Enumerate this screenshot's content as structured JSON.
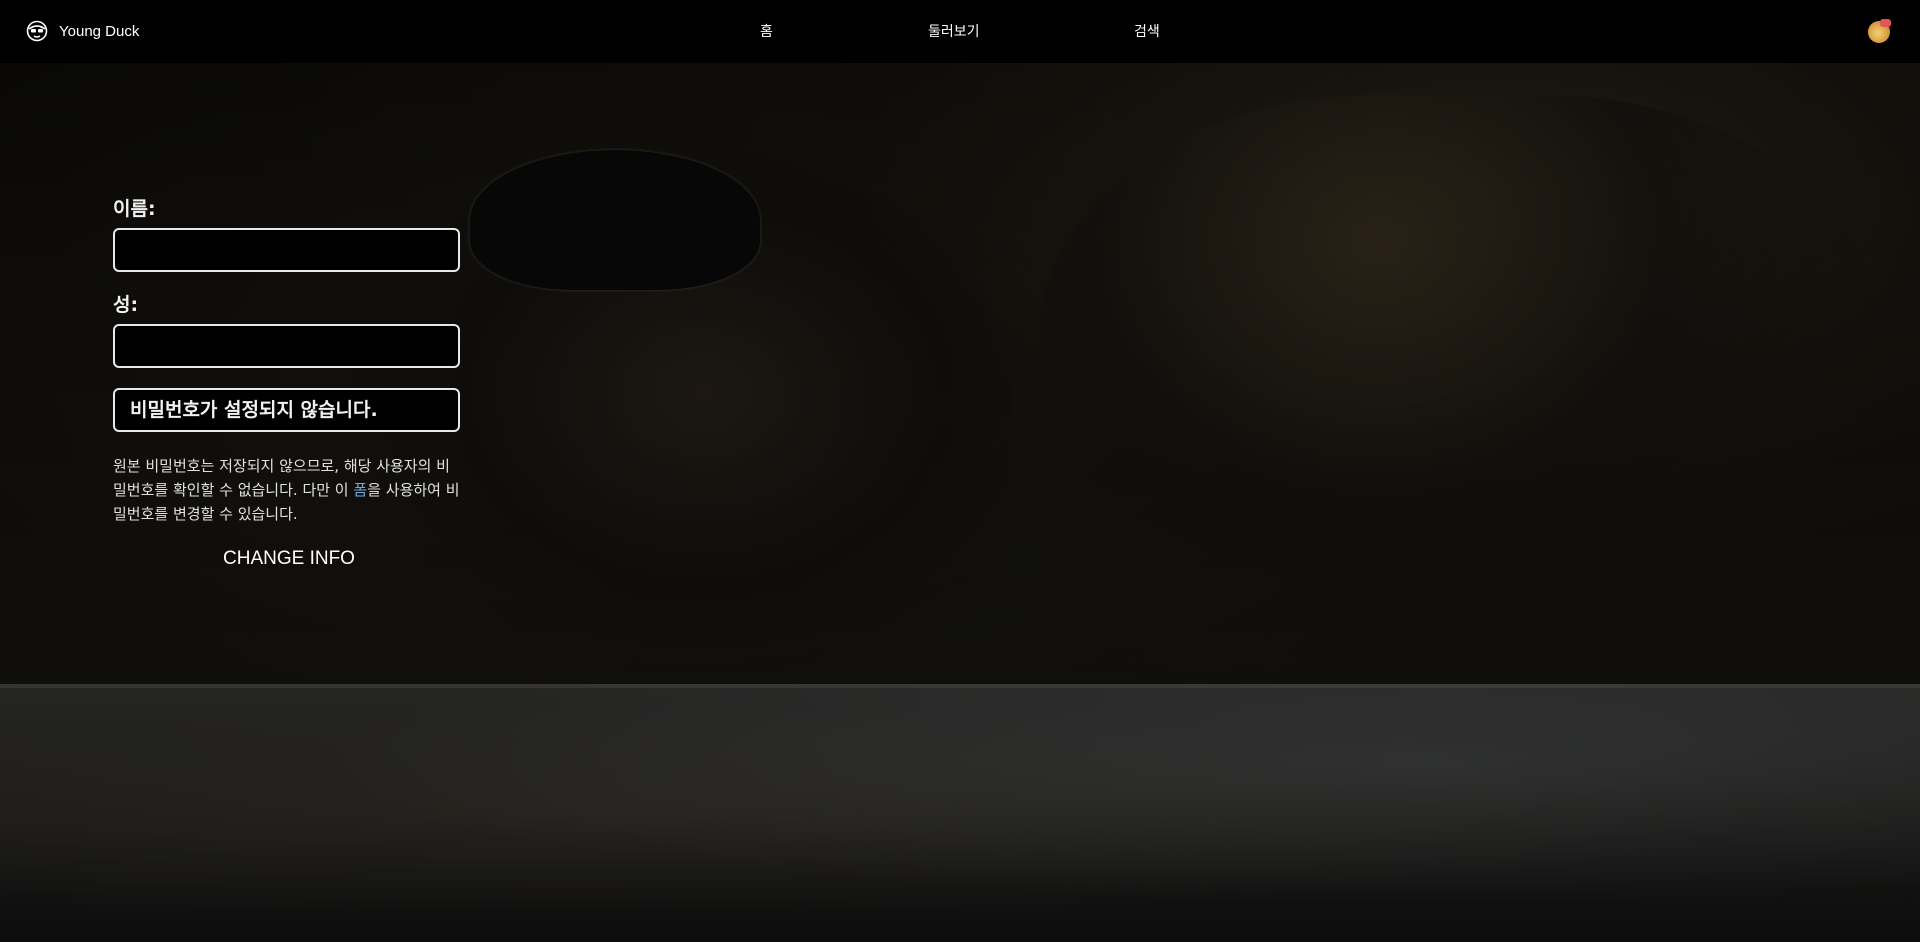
{
  "brand": {
    "name": "Young Duck",
    "logo_icon": "duck-logo-icon"
  },
  "nav": {
    "home": "홈",
    "explore": "둘러보기",
    "search": "검색"
  },
  "profile": {
    "avatar_icon": "user-avatar-icon"
  },
  "form": {
    "first_name_label": "이름:",
    "first_name_value": "",
    "last_name_label": "성:",
    "last_name_value": "",
    "password_status": "비밀번호가 설정되지 않습니다.",
    "help_before_link": "원본 비밀번호는 저장되지 않으므로, 해당 사용자의 비밀번호를 확인할 수 없습니다. 다만 이 ",
    "help_link": "폼",
    "help_after_link": "을 사용하여 비밀번호를 변경할 수 있습니다.",
    "submit_label": "CHANGE INFO"
  },
  "colors": {
    "background": "#000000",
    "text": "#ffffff",
    "link": "#6ea8e6",
    "border": "#e8e8e8"
  }
}
